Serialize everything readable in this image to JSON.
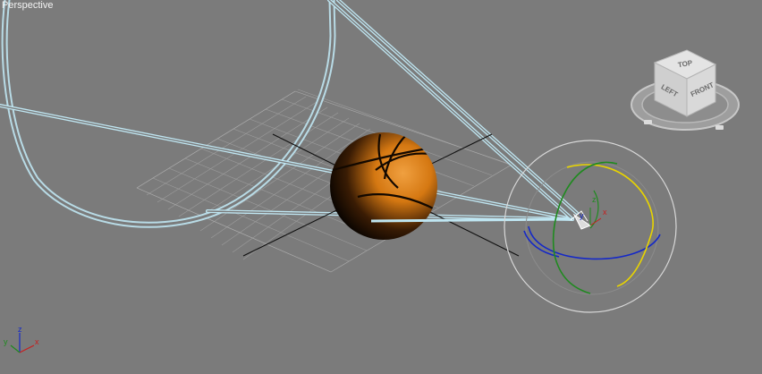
{
  "viewport": {
    "label": "Perspective",
    "background": "#7b7b7b"
  },
  "viewcube": {
    "face_top": "TOP",
    "face_left": "LEFT",
    "face_front": "FRONT",
    "icon": "viewcube-icon"
  },
  "gizmo": {
    "axis_x": "x",
    "axis_y": "y",
    "axis_z": "z",
    "icon": "rotate-gizmo-icon"
  },
  "world_axis": {
    "axis_x": "x",
    "axis_y": "y",
    "axis_z": "z"
  },
  "colors": {
    "wire_cyan": "#bfe6f2",
    "grid": "#9a9a9a",
    "ball_orange": "#e07a12",
    "gizmo_yellow": "#e8d400",
    "gizmo_green": "#1f8a1f",
    "gizmo_blue": "#1428c8",
    "axis_red": "#c81e1e"
  }
}
